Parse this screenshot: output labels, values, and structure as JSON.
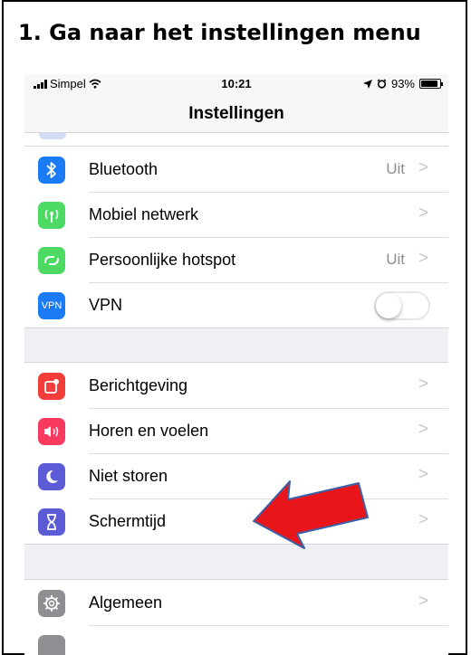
{
  "instruction": "1.   Ga naar het instellingen menu",
  "status_bar": {
    "carrier": "Simpel",
    "time": "10:21",
    "battery": "93%"
  },
  "nav": {
    "title": "Instellingen"
  },
  "group1": [
    {
      "label": "Bluetooth",
      "value": "Uit",
      "icon": "bluetooth-icon",
      "color": "#1a7bf5"
    },
    {
      "label": "Mobiel netwerk",
      "value": "",
      "icon": "antenna-icon",
      "color": "#4cd964"
    },
    {
      "label": "Persoonlijke hotspot",
      "value": "Uit",
      "icon": "hotspot-icon",
      "color": "#4cd964"
    },
    {
      "label": "VPN",
      "icon_text": "VPN",
      "icon": "vpn-icon",
      "color": "#1a7bf5",
      "toggle_on": false
    }
  ],
  "group2": [
    {
      "label": "Berichtgeving",
      "icon": "notifications-icon",
      "color": "#f23d3a"
    },
    {
      "label": "Horen en voelen",
      "icon": "sound-icon",
      "color": "#f73a5e"
    },
    {
      "label": "Niet storen",
      "icon": "moon-icon",
      "color": "#5b5bd6"
    },
    {
      "label": "Schermtijd",
      "icon": "hourglass-icon",
      "color": "#5b5bd6"
    }
  ],
  "group3": [
    {
      "label": "Algemeen",
      "icon": "gear-icon",
      "color": "#8e8e93"
    }
  ],
  "annotation": {
    "arrow_color": "#e8161b",
    "arrow_outline": "#3a62a8"
  }
}
